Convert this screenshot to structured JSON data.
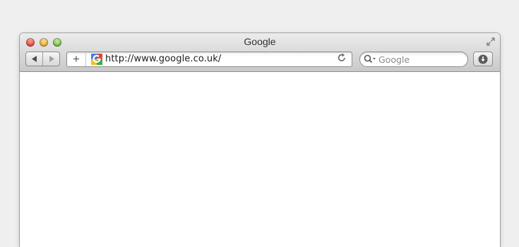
{
  "window": {
    "title": "Google",
    "traffic_lights": [
      "close-icon",
      "minimize-icon",
      "zoom-icon"
    ],
    "fullscreen_icon": "fullscreen-arrows-icon"
  },
  "navigation": {
    "back_icon": "back-arrow-icon",
    "forward_icon": "forward-arrow-icon"
  },
  "address_bar": {
    "add_bookmark_glyph": "+",
    "favicon": "google-favicon",
    "url": "http://www.google.co.uk/",
    "reload_icon": "reload-icon"
  },
  "search_bar": {
    "placeholder": "Google",
    "icon": "search-icon"
  },
  "downloads": {
    "icon": "download-icon"
  },
  "colors": {
    "favicon_blue": "#4a7fe0",
    "favicon_red": "#e0452f",
    "favicon_yellow": "#f2c120",
    "favicon_green": "#3ea84a"
  }
}
